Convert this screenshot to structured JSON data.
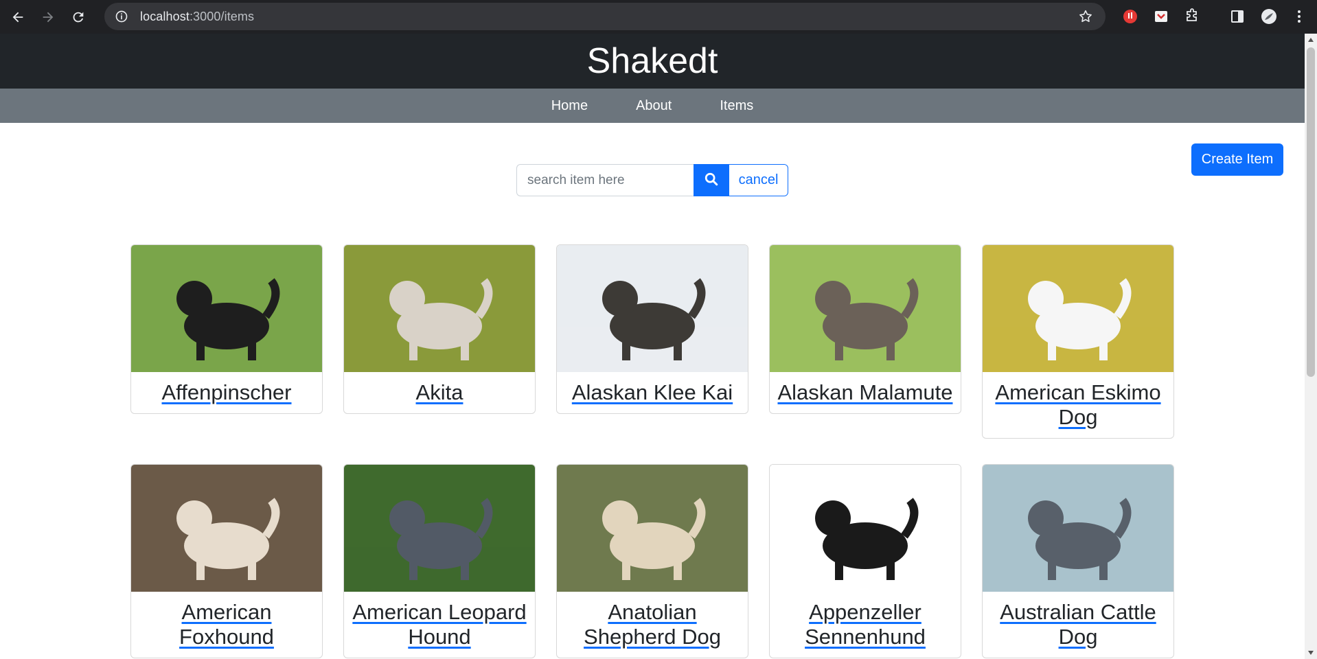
{
  "browser": {
    "url_host": "localhost",
    "url_rest": ":3000/items"
  },
  "site": {
    "title": "Shakedt",
    "nav": [
      "Home",
      "About",
      "Items"
    ]
  },
  "toolbar": {
    "create_label": "Create Item",
    "search_placeholder": "search item here",
    "cancel_label": "cancel"
  },
  "items": [
    {
      "name": "Affenpinscher",
      "bg": "#7aa54a",
      "dog": "#1e1e1e"
    },
    {
      "name": "Akita",
      "bg": "#8a9a3a",
      "dog": "#d9d2c8"
    },
    {
      "name": "Alaskan Klee Kai",
      "bg": "#e9edf1",
      "dog": "#3d3a36"
    },
    {
      "name": "Alaskan Malamute",
      "bg": "#9bbf5e",
      "dog": "#6b6158"
    },
    {
      "name": "American Eskimo Dog",
      "bg": "#c8b642",
      "dog": "#f6f6f6"
    },
    {
      "name": "American Foxhound",
      "bg": "#6b5a48",
      "dog": "#e7dccd"
    },
    {
      "name": "American Leopard Hound",
      "bg": "#3f6a2d",
      "dog": "#525a66"
    },
    {
      "name": "Anatolian Shepherd Dog",
      "bg": "#6f7a4e",
      "dog": "#e2d5bd"
    },
    {
      "name": "Appenzeller Sennenhund",
      "bg": "#ffffff",
      "dog": "#1a1a1a"
    },
    {
      "name": "Australian Cattle Dog",
      "bg": "#a9c2cc",
      "dog": "#58606a"
    }
  ]
}
